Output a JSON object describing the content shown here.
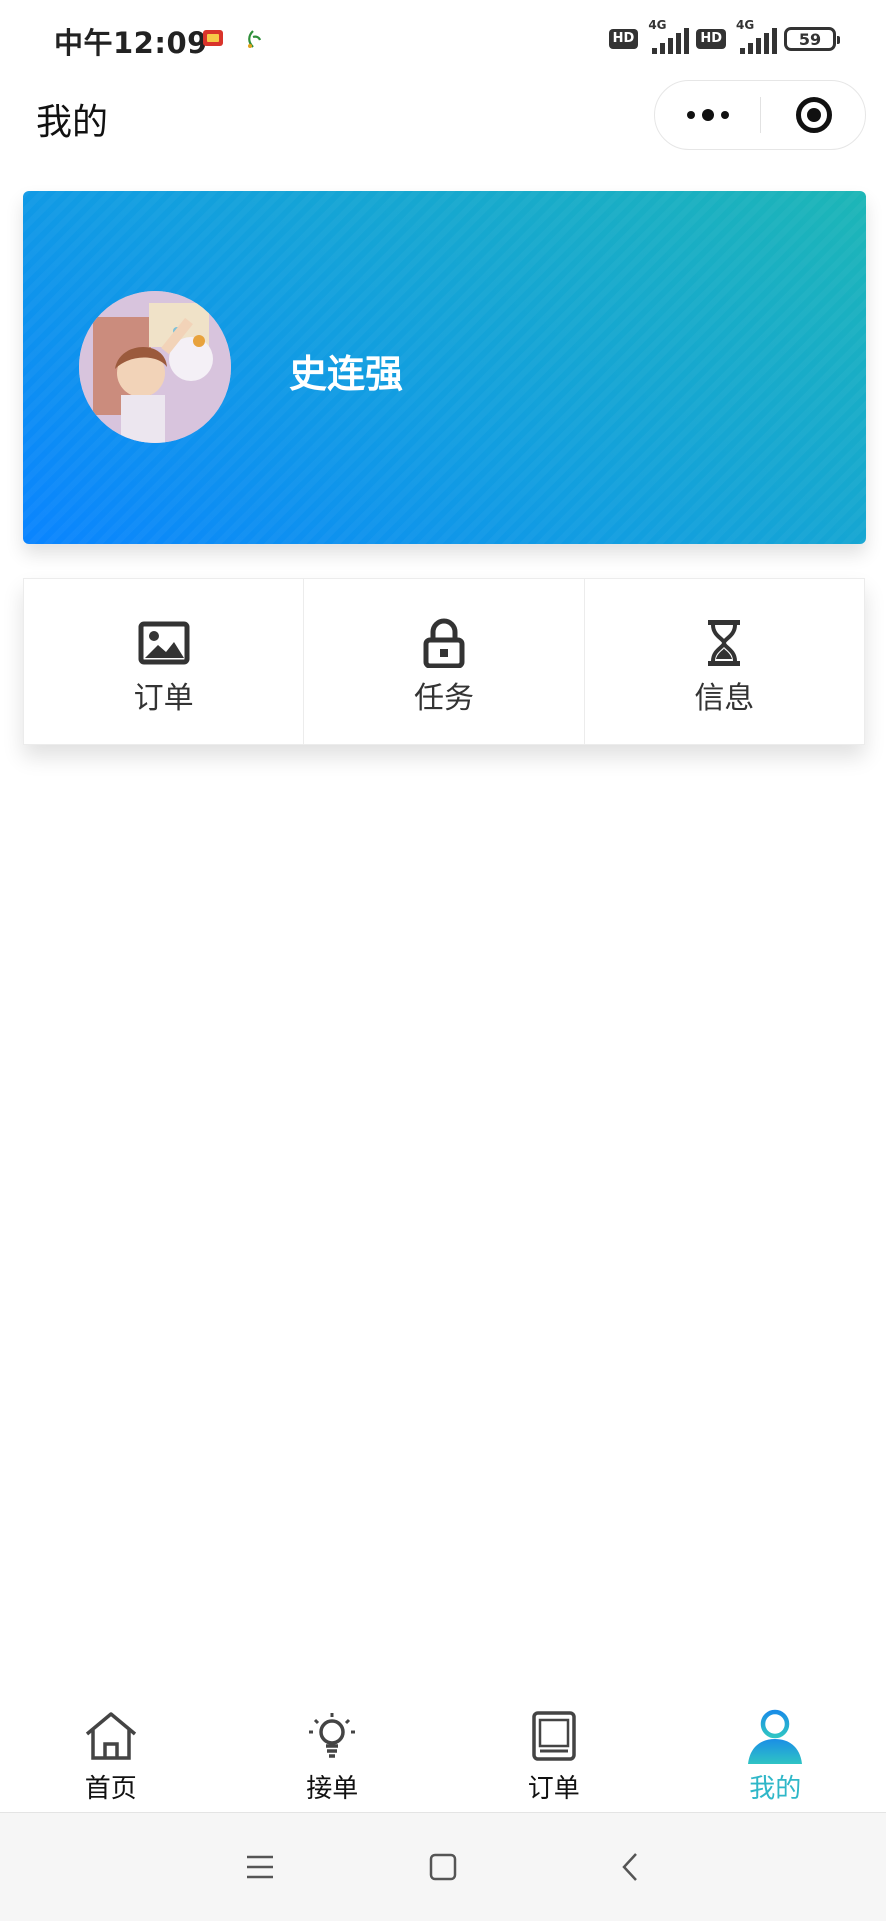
{
  "status_bar": {
    "time": "中午12:09",
    "hd_1": "HD",
    "network_1": "4G",
    "hd_2": "HD",
    "network_2": "4G",
    "battery": "59"
  },
  "nav": {
    "title": "我的"
  },
  "profile": {
    "name": "史连强"
  },
  "menu": {
    "items": [
      {
        "label": "订单",
        "icon": "image-icon"
      },
      {
        "label": "任务",
        "icon": "lock-icon"
      },
      {
        "label": "信息",
        "icon": "hourglass-icon"
      }
    ]
  },
  "tabbar": {
    "items": [
      {
        "label": "首页",
        "icon": "home-icon"
      },
      {
        "label": "接单",
        "icon": "lightbulb-icon"
      },
      {
        "label": "订单",
        "icon": "tablet-icon"
      },
      {
        "label": "我的",
        "icon": "user-icon",
        "active": true
      }
    ],
    "active_color": "#2fb7c8"
  },
  "colors": {
    "card_gradient_start": "#0a84ff",
    "card_gradient_end": "#1db6b6",
    "system_nav_bg": "#f6f6f6"
  }
}
